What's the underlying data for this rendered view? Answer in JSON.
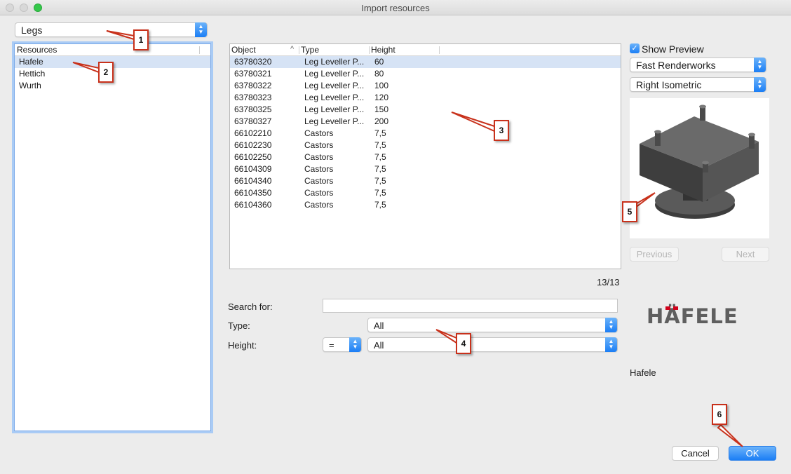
{
  "window": {
    "title": "Import resources"
  },
  "category_popup": {
    "value": "Legs"
  },
  "resources": {
    "header": "Resources",
    "items": [
      "Hafele",
      "Hettich",
      "Wurth"
    ],
    "selected_index": 0
  },
  "objects_table": {
    "columns": [
      "Object",
      "Type",
      "Height"
    ],
    "sort_indicator": "^",
    "rows": [
      [
        "63780320",
        "Leg Leveller P...",
        "60"
      ],
      [
        "63780321",
        "Leg Leveller P...",
        "80"
      ],
      [
        "63780322",
        "Leg Leveller P...",
        "100"
      ],
      [
        "63780323",
        "Leg Leveller P...",
        "120"
      ],
      [
        "63780325",
        "Leg Leveller P...",
        "150"
      ],
      [
        "63780327",
        "Leg Leveller P...",
        "200"
      ],
      [
        "66102210",
        "Castors",
        "7,5"
      ],
      [
        "66102230",
        "Castors",
        "7,5"
      ],
      [
        "66102250",
        "Castors",
        "7,5"
      ],
      [
        "66104309",
        "Castors",
        "7,5"
      ],
      [
        "66104340",
        "Castors",
        "7,5"
      ],
      [
        "66104350",
        "Castors",
        "7,5"
      ],
      [
        "66104360",
        "Castors",
        "7,5"
      ]
    ],
    "selected_index": 0,
    "count": "13/13"
  },
  "filters": {
    "search_label": "Search for:",
    "search_value": "",
    "type_label": "Type:",
    "type_value": "All",
    "height_label": "Height:",
    "height_operator": "=",
    "height_value": "All"
  },
  "preview": {
    "show_preview_label": "Show Preview",
    "show_preview_checked": true,
    "render_mode": "Fast Renderworks",
    "view": "Right Isometric",
    "previous_label": "Previous",
    "next_label": "Next",
    "brand_logo": "HÄFELE",
    "brand_name": "Hafele"
  },
  "footer": {
    "cancel_label": "Cancel",
    "ok_label": "OK"
  },
  "callouts": [
    "1",
    "2",
    "3",
    "4",
    "5",
    "6"
  ],
  "colors": {
    "accent": "#1b7ef5",
    "selection": "#d6e3f5",
    "callout_border": "#c8311b",
    "logo_gray": "#5f5f5f",
    "logo_red": "#d0021b"
  }
}
